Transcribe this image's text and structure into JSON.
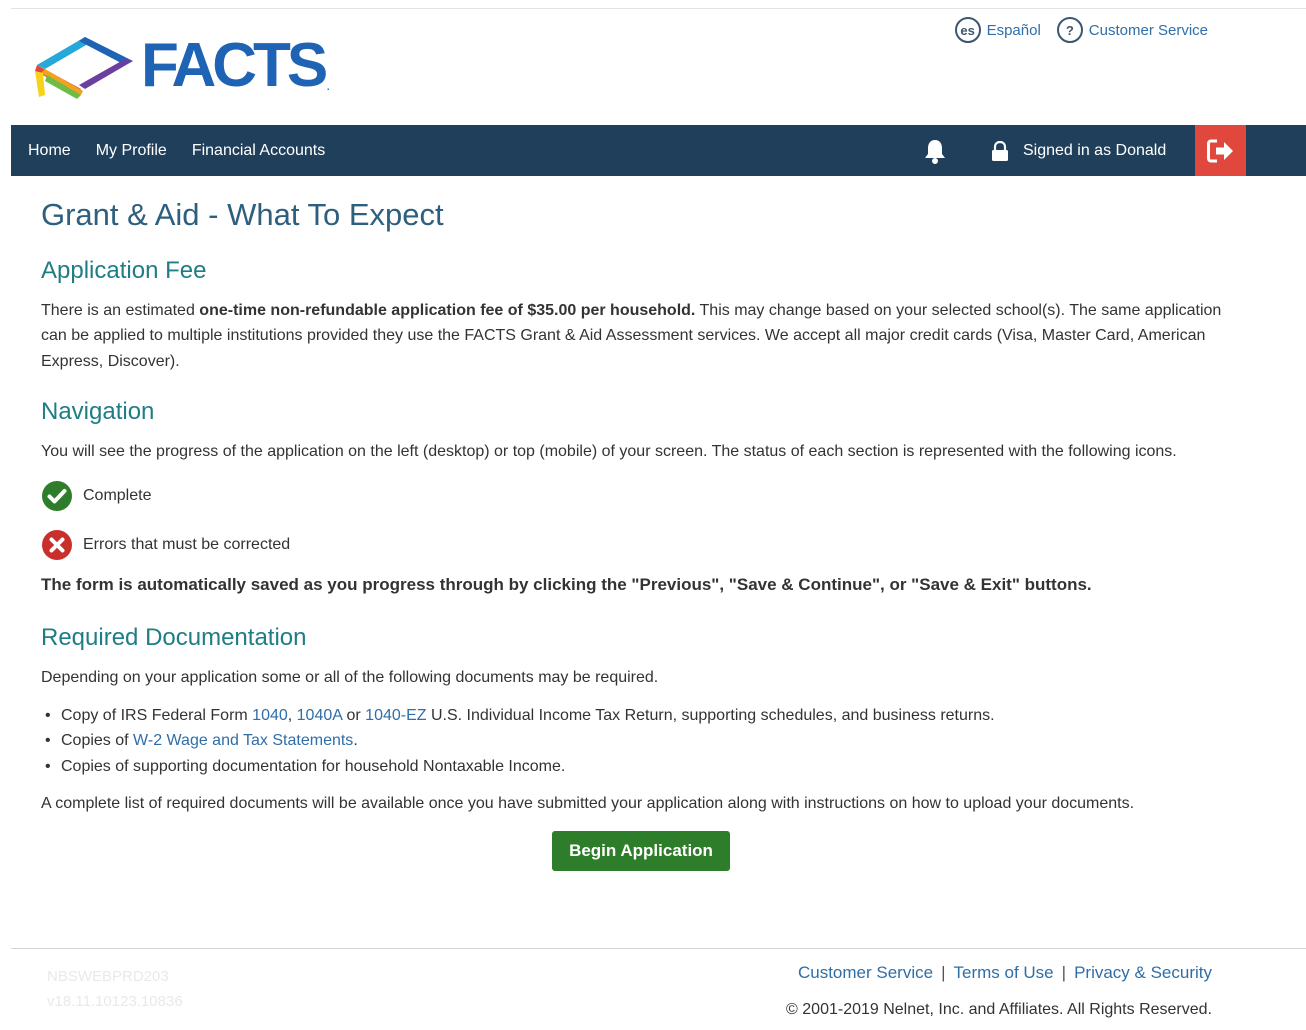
{
  "header": {
    "logo_text": "FACTS",
    "util_links": [
      {
        "icon": "es",
        "label": "Español"
      },
      {
        "icon": "?",
        "label": "Customer Service"
      }
    ]
  },
  "nav": {
    "items": [
      "Home",
      "My Profile",
      "Financial Accounts"
    ],
    "signed_in": "Signed in as Donald"
  },
  "page": {
    "title": "Grant & Aid - What To Expect",
    "fee": {
      "heading": "Application Fee",
      "text_before": "There is an estimated ",
      "text_bold": "one-time non-refundable application fee of $35.00 per household.",
      "text_after": " This may change based on your selected school(s). The same application can be applied to multiple institutions provided they use the FACTS Grant & Aid Assessment services. We accept all major credit cards (Visa, Master Card, American Express, Discover)."
    },
    "navigation": {
      "heading": "Navigation",
      "text": "You will see the progress of the application on the left (desktop) or top (mobile) of your screen. The status of each section is represented with the following icons.",
      "statuses": [
        {
          "icon": "check-circle",
          "label": "Complete",
          "color": "#2e7d2a"
        },
        {
          "icon": "x-circle",
          "label": "Errors that must be corrected",
          "color": "#c9302c"
        }
      ],
      "note": "The form is automatically saved as you progress through by clicking the \"Previous\", \"Save & Continue\", or \"Save & Exit\" buttons."
    },
    "docs": {
      "heading": "Required Documentation",
      "intro": "Depending on your application some or all of the following documents may be required.",
      "item1": {
        "prefix": "Copy of IRS Federal Form ",
        "link1": "1040",
        "sep1": ", ",
        "link2": "1040A",
        "sep2": " or ",
        "link3": "1040-EZ",
        "suffix": " U.S. Individual Income Tax Return, supporting schedules, and business returns."
      },
      "item2": {
        "prefix": "Copies of ",
        "link": "W-2 Wage and Tax Statements",
        "suffix": "."
      },
      "item3": "Copies of supporting documentation for household Nontaxable Income.",
      "outro": "A complete list of required documents will be available once you have submitted your application along with instructions on how to upload your documents."
    },
    "button": "Begin Application"
  },
  "footer": {
    "server": "NBSWEBPRD203",
    "version": "v18.11.10123.10836",
    "links": [
      "Customer Service",
      "Terms of Use",
      "Privacy & Security"
    ],
    "separator": "|",
    "copyright": "© 2001-2019 Nelnet, Inc. and Affiliates. All Rights Reserved."
  },
  "colors": {
    "navbar": "#1f3f5b",
    "logout": "#e0483d",
    "title": "#2d5f7f",
    "heading": "#1f7d86",
    "link": "#2f6ea8",
    "button": "#2e7d2a"
  }
}
